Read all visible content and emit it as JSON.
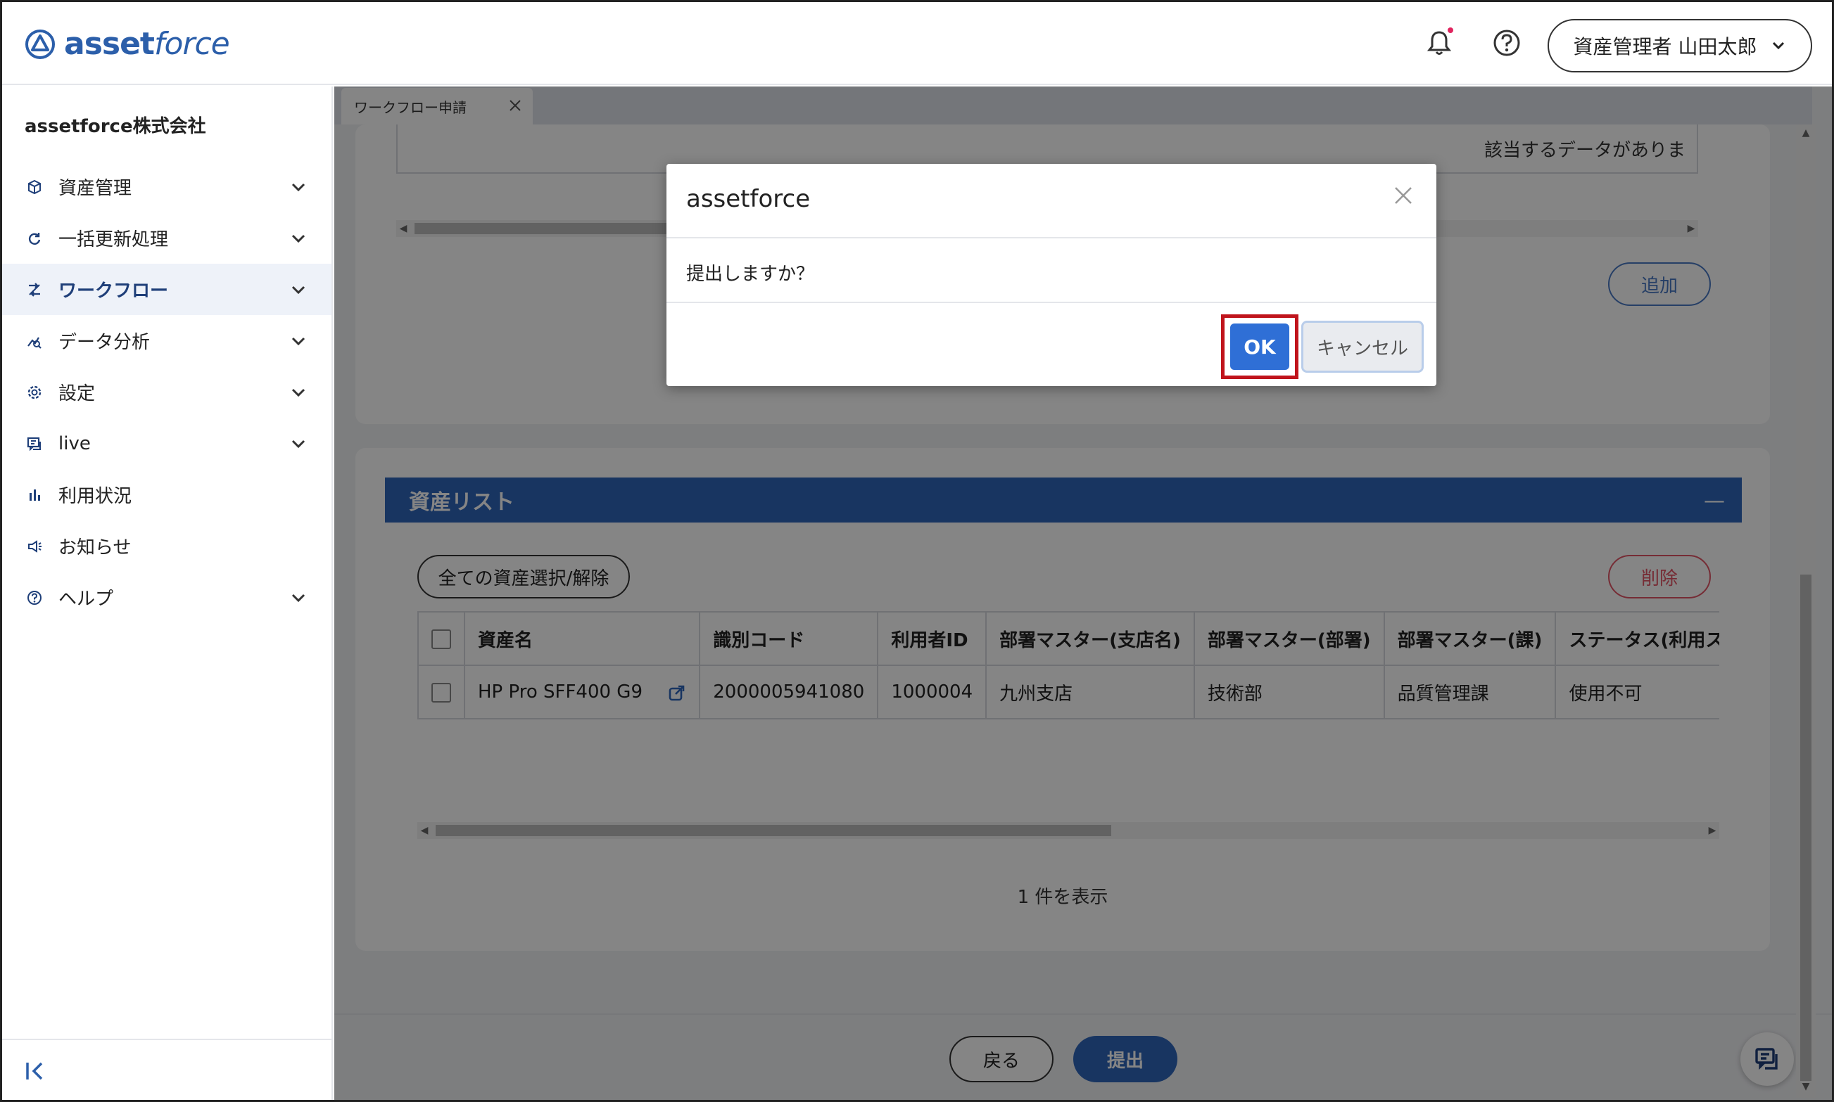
{
  "header": {
    "logo_text_asset": "asset",
    "logo_text_force": "force",
    "user_label": "資産管理者 山田太郎"
  },
  "sidebar": {
    "company": "assetforce株式会社",
    "items": [
      {
        "label": "資産管理",
        "icon": "cube-icon",
        "has_chevron": true
      },
      {
        "label": "一括更新処理",
        "icon": "refresh-icon",
        "has_chevron": true
      },
      {
        "label": "ワークフロー",
        "icon": "workflow-icon",
        "has_chevron": true,
        "active": true
      },
      {
        "label": "データ分析",
        "icon": "analytics-icon",
        "has_chevron": true
      },
      {
        "label": "設定",
        "icon": "gear-icon",
        "has_chevron": true
      },
      {
        "label": "live",
        "icon": "chat-icon",
        "has_chevron": true
      },
      {
        "label": "利用状況",
        "icon": "bar-chart-icon",
        "has_chevron": false
      },
      {
        "label": "お知らせ",
        "icon": "megaphone-icon",
        "has_chevron": false
      },
      {
        "label": "ヘルプ",
        "icon": "help-icon",
        "has_chevron": true
      }
    ]
  },
  "tabs": [
    {
      "label": "ワークフロー申請"
    }
  ],
  "card1": {
    "nodata_text": "該当するデータがありま",
    "add_button": "追加"
  },
  "asset_list": {
    "title": "資産リスト",
    "collapse_symbol": "—",
    "select_all_button": "全ての資産選択/解除",
    "delete_button": "削除",
    "columns": [
      "資産名",
      "識別コード",
      "利用者ID",
      "部署マスター(支店名)",
      "部署マスター(部署)",
      "部署マスター(課)",
      "ステータス(利用ステータ"
    ],
    "rows": [
      [
        "HP Pro SFF400 G9",
        "2000005941080",
        "1000004",
        "九州支店",
        "技術部",
        "品質管理課",
        "使用不可"
      ]
    ],
    "count_text": "1 件を表示"
  },
  "footer": {
    "back_button": "戻る",
    "submit_button": "提出"
  },
  "modal": {
    "title": "assetforce",
    "message": "提出しますか？",
    "ok_button": "OK",
    "cancel_button": "キャンセル"
  },
  "colors": {
    "brand": "#2c5faa",
    "primary": "#2f66bb",
    "ok_button": "#2f6fd6",
    "highlight": "#c0141c",
    "danger": "#e25567"
  }
}
